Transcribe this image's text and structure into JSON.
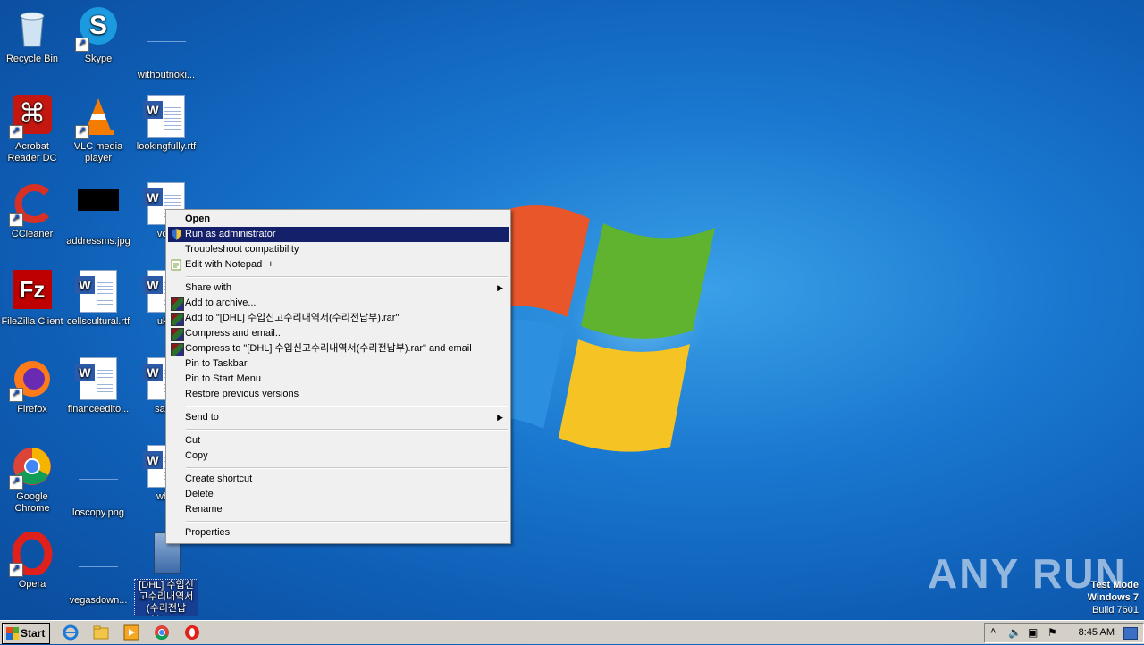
{
  "desktop": {
    "icons": [
      {
        "label": "Recycle Bin"
      },
      {
        "label": "Skype"
      },
      {
        "label": "withoutnoki..."
      },
      {
        "label": "Acrobat Reader DC"
      },
      {
        "label": "VLC media player"
      },
      {
        "label": "lookingfully.rtf"
      },
      {
        "label": "CCleaner"
      },
      {
        "label": "addressms.jpg"
      },
      {
        "label": "volh"
      },
      {
        "label": "FileZilla Client"
      },
      {
        "label": "cellscultural.rtf"
      },
      {
        "label": "ukbl"
      },
      {
        "label": "Firefox"
      },
      {
        "label": "financeedito..."
      },
      {
        "label": "sawp"
      },
      {
        "label": "Google Chrome"
      },
      {
        "label": "loscopy.png"
      },
      {
        "label": "whic"
      },
      {
        "label": "Opera"
      },
      {
        "label": "vegasdown..."
      },
      {
        "label": "[DHL] 수입신고수리내역서(수리전납부).exe"
      }
    ]
  },
  "context_menu": {
    "items": [
      {
        "label": "Open"
      },
      {
        "label": "Run as administrator"
      },
      {
        "label": "Troubleshoot compatibility"
      },
      {
        "label": "Edit with Notepad++"
      },
      {
        "label": "Share with"
      },
      {
        "label": "Add to archive..."
      },
      {
        "label": "Add to \"[DHL] 수입신고수리내역서(수리전납부).rar\""
      },
      {
        "label": "Compress and email..."
      },
      {
        "label": "Compress to \"[DHL] 수입신고수리내역서(수리전납부).rar\" and email"
      },
      {
        "label": "Pin to Taskbar"
      },
      {
        "label": "Pin to Start Menu"
      },
      {
        "label": "Restore previous versions"
      },
      {
        "label": "Send to"
      },
      {
        "label": "Cut"
      },
      {
        "label": "Copy"
      },
      {
        "label": "Create shortcut"
      },
      {
        "label": "Delete"
      },
      {
        "label": "Rename"
      },
      {
        "label": "Properties"
      }
    ]
  },
  "taskbar": {
    "start_label": "Start",
    "clock": "8:45 AM"
  },
  "watermark": {
    "brand": "ANY RUN",
    "mode": "Test Mode",
    "os": "Windows 7",
    "build": "Build 7601"
  },
  "colors": {
    "highlight": "#15206a",
    "desktop": "#1a78cf"
  }
}
